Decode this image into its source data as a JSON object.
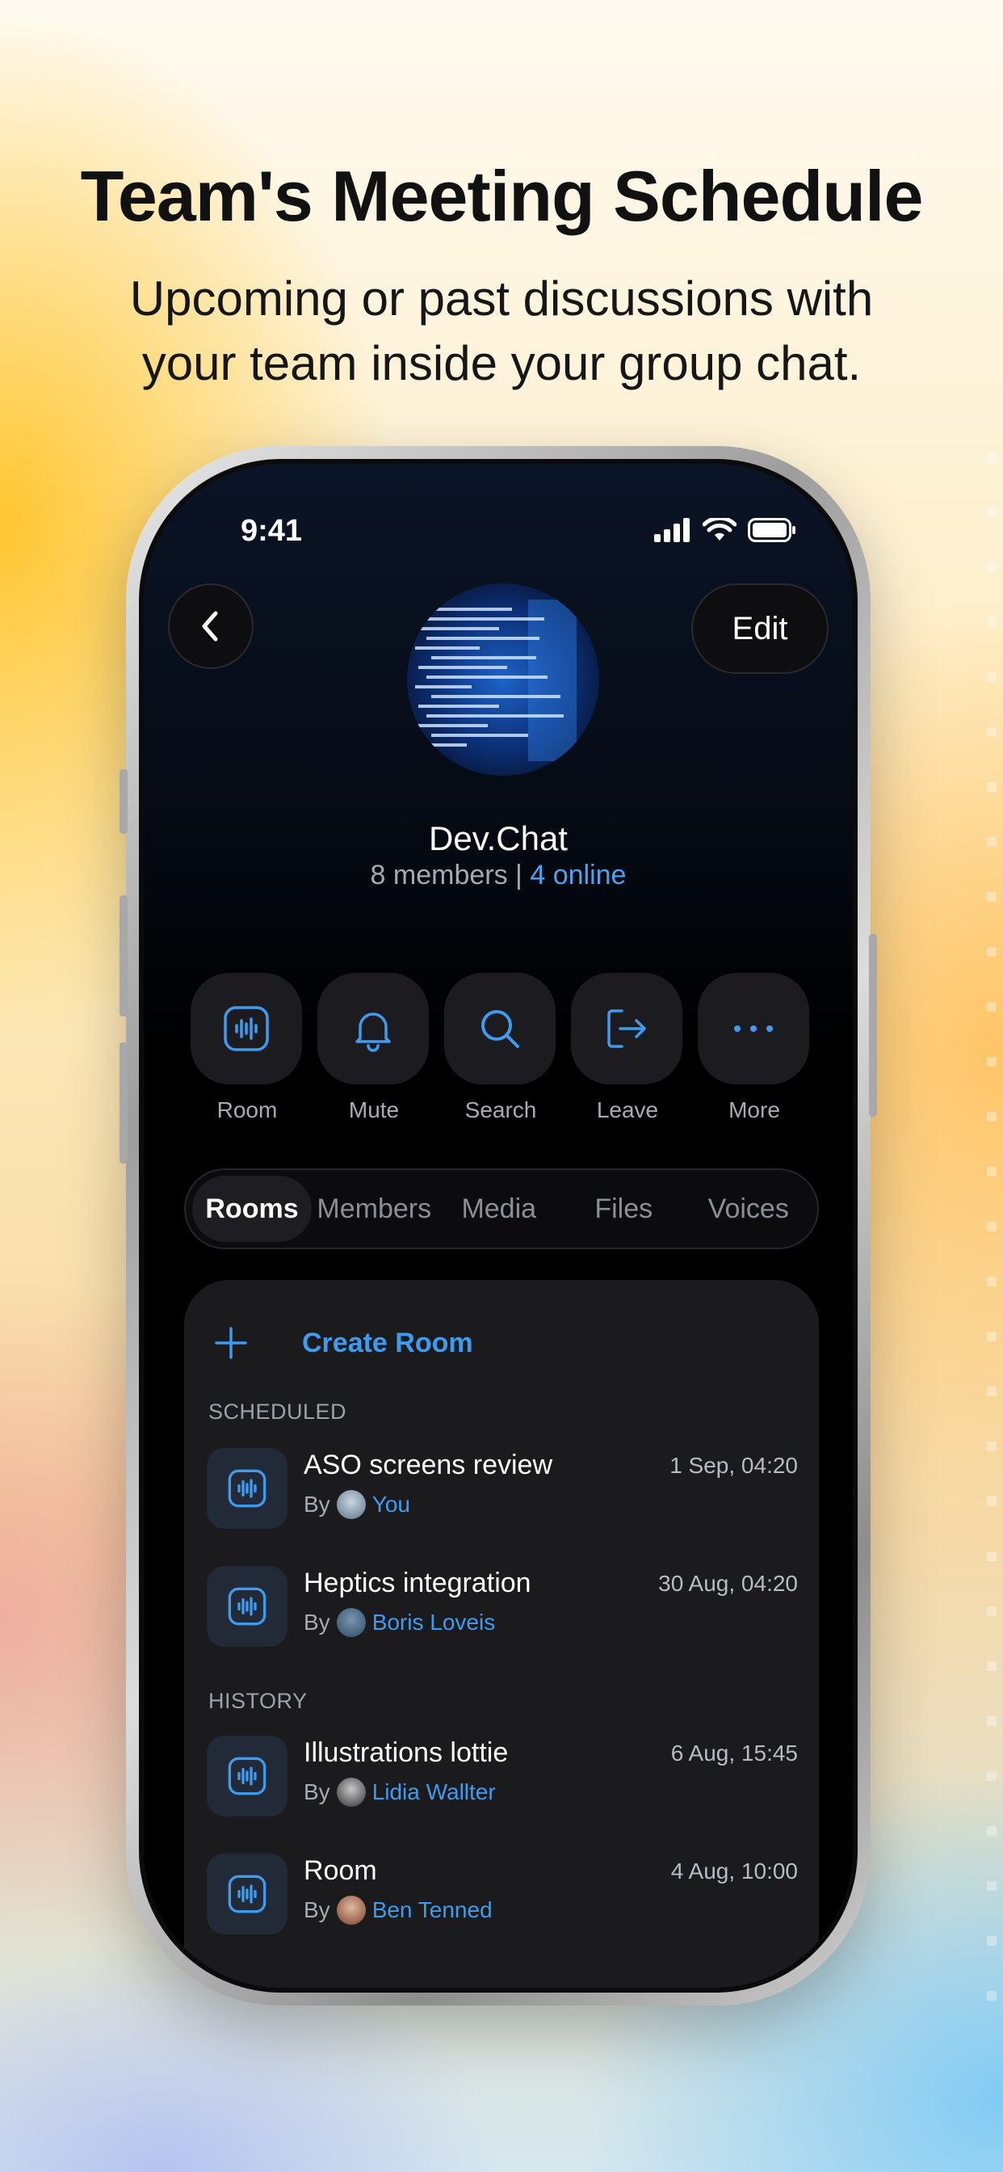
{
  "headline": "Team's Meeting Schedule",
  "subhead_line1": "Upcoming or past discussions with",
  "subhead_line2": "your team inside your group chat.",
  "status": {
    "time": "9:41"
  },
  "header": {
    "edit_label": "Edit",
    "chat_name": "Dev.Chat",
    "members": "8 members",
    "separator": "|",
    "online": "4 online"
  },
  "actions": [
    {
      "label": "Room",
      "icon": "room-waveform-icon"
    },
    {
      "label": "Mute",
      "icon": "bell-icon"
    },
    {
      "label": "Search",
      "icon": "search-icon"
    },
    {
      "label": "Leave",
      "icon": "leave-icon"
    },
    {
      "label": "More",
      "icon": "more-dots-icon"
    }
  ],
  "tabs": [
    "Rooms",
    "Members",
    "Media",
    "Files",
    "Voices"
  ],
  "active_tab": "Rooms",
  "rooms_card": {
    "create_label": "Create Room",
    "scheduled_label": "SCHEDULED",
    "history_label": "HISTORY",
    "by_label": "By",
    "scheduled": [
      {
        "title": "ASO screens review",
        "by": "You",
        "date": "1 Sep, 04:20"
      },
      {
        "title": "Heptics integration",
        "by": "Boris Loveis",
        "date": "30 Aug, 04:20"
      }
    ],
    "history": [
      {
        "title": "Illustrations lottie",
        "by": "Lidia Wallter",
        "date": "6 Aug, 15:45"
      },
      {
        "title": "Room",
        "by": "Ben Tenned",
        "date": "4 Aug, 10:00"
      }
    ]
  },
  "colors": {
    "accent": "#3D9CF0",
    "card": "#1B1B1E",
    "screen_bg": "#000000"
  }
}
